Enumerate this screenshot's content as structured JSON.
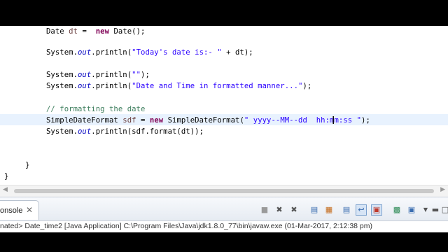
{
  "editor": {
    "line_dt": {
      "type": "Date",
      "var": "dt",
      "op": " =  ",
      "kw_new": "new",
      "rest": " Date();"
    },
    "line_today": {
      "sys": "System.",
      "out": "out",
      "call": ".println(",
      "str": "\"Today's date is:- \"",
      "tail": " + dt);"
    },
    "line_empty": {
      "sys": "System.",
      "out": "out",
      "call": ".println(",
      "str": "\"\"",
      "tail": ");"
    },
    "line_format_msg": {
      "sys": "System.",
      "out": "out",
      "call": ".println(",
      "str": "\"Date and Time in formatted manner...\"",
      "tail": ");"
    },
    "comment": "// formatting the date",
    "line_sdf": {
      "type": "SimpleDateFormat",
      "var": "sdf",
      "op": " = ",
      "kw_new": "new",
      "rest": " SimpleDateFormat(",
      "str": "\" yyyy--MM--dd  hh:mm:ss \"",
      "tail": ");"
    },
    "line_print_fmt": {
      "sys": "System.",
      "out": "out",
      "call": ".println(",
      "rest": "sdf.format(dt));"
    },
    "brace_inner": "}",
    "brace_outer": "}"
  },
  "console": {
    "tab_label": "onsole",
    "status": "nated> Date_time2 [Java Application] C:\\Program Files\\Java\\jdk1.8.0_77\\bin\\javaw.exe (01-Mar-2017, 2:12:38 pm)"
  },
  "toolbar_icons": [
    "terminate-icon",
    "remove-launch-icon",
    "remove-all-terminated-icon",
    "clear-console-icon",
    "scroll-lock-icon",
    "show-when-stdout-icon",
    "word-wrap-icon",
    "pin-console-icon",
    "display-selected-console-icon",
    "open-console-icon",
    "view-menu-icon",
    "minimize-icon",
    "maximize-icon"
  ]
}
